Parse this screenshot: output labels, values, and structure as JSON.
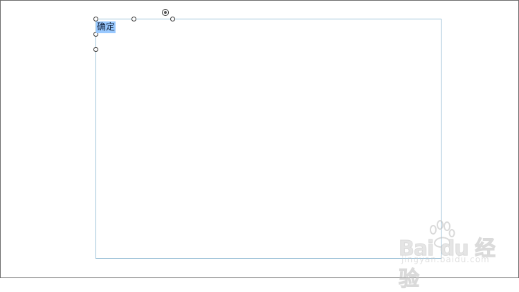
{
  "form": {
    "button_label": "确定"
  },
  "watermark": {
    "brand": "Bai du 经验",
    "subtitle": "jingyan.baidu.com"
  },
  "colors": {
    "selection_highlight": "#99c9ff",
    "form_border": "#9fc3d9",
    "frame_border": "#6b6b6b"
  }
}
